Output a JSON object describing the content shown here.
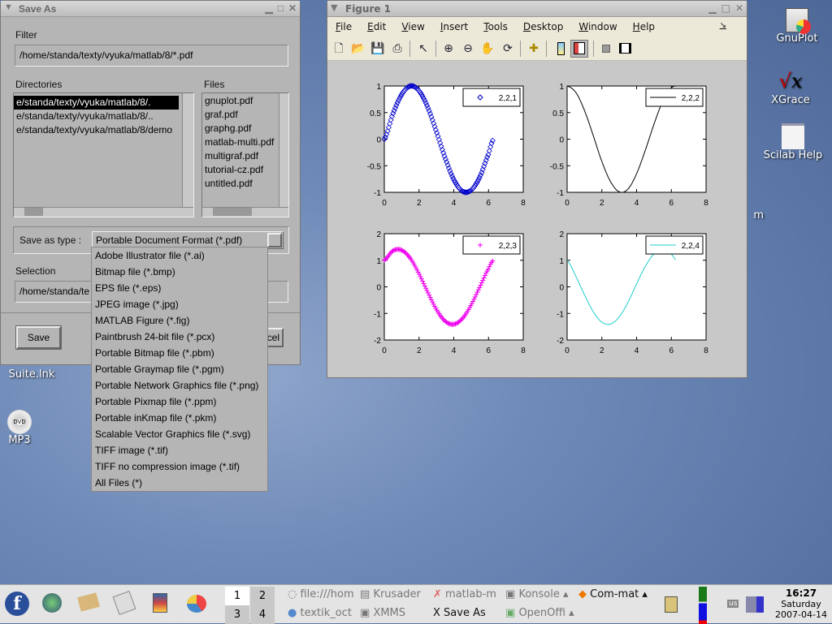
{
  "save_dialog": {
    "title": "Save As",
    "filter_label": "Filter",
    "filter_value": "/home/standa/texty/vyuka/matlab/8/*.pdf",
    "directories_label": "Directories",
    "directories": [
      "e/standa/texty/vyuka/matlab/8/.",
      "e/standa/texty/vyuka/matlab/8/..",
      "e/standa/texty/vyuka/matlab/8/demo"
    ],
    "files_label": "Files",
    "files": [
      "gnuplot.pdf",
      "graf.pdf",
      "graphg.pdf",
      "matlab-multi.pdf",
      "multigraf.pdf",
      "tutorial-cz.pdf",
      "untitled.pdf"
    ],
    "save_type_label": "Save as type :",
    "save_type_value": "Portable Document Format (*.pdf)",
    "selection_label": "Selection",
    "selection_value": "/home/standa/te",
    "save_button": "Save",
    "cancel_button": "cel",
    "type_options": [
      "Adobe Illustrator file (*.ai)",
      "Bitmap file (*.bmp)",
      "EPS file (*.eps)",
      "JPEG image (*.jpg)",
      "MATLAB Figure (*.fig)",
      "Paintbrush 24-bit file (*.pcx)",
      "Portable Bitmap file (*.pbm)",
      "Portable Graymap file (*.pgm)",
      "Portable Network Graphics file (*.png)",
      "Portable Pixmap file (*.ppm)",
      "Portable inKmap file (*.pkm)",
      "Scalable Vector Graphics file (*.svg)",
      "TIFF image (*.tif)",
      "TIFF no compression image (*.tif)",
      "All Files (*)"
    ]
  },
  "figure": {
    "title": "Figure 1",
    "menu": [
      "File",
      "Edit",
      "View",
      "Insert",
      "Tools",
      "Desktop",
      "Window",
      "Help"
    ],
    "toolbar": [
      "new-file",
      "open-file",
      "save",
      "print",
      "select-arrow",
      "zoom-in",
      "zoom-out",
      "pan-hand",
      "rotate-3d",
      "insert-data-cursor",
      "colorbar",
      "legend",
      "hide-plot-tools",
      "show-plot-tools"
    ]
  },
  "chart_data": [
    {
      "type": "scatter",
      "marker": "diamond",
      "color": "#0000cc",
      "legend": "2,2,1",
      "legend_placement": "top-right",
      "xlim": [
        0,
        8
      ],
      "ylim": [
        -1,
        1
      ],
      "xticks": [
        "0",
        "2",
        "4",
        "6",
        "8"
      ],
      "yticks": [
        "-1",
        "-0.5",
        "0",
        "0.5",
        "1"
      ],
      "x": [
        0,
        0.5,
        1,
        1.5,
        2,
        2.5,
        3,
        3.5,
        4,
        4.5,
        5,
        5.5,
        6,
        6.28
      ],
      "y": [
        0,
        0.48,
        0.84,
        1.0,
        0.91,
        0.6,
        0.14,
        -0.35,
        -0.76,
        -0.98,
        -0.96,
        -0.71,
        -0.28,
        0
      ]
    },
    {
      "type": "line",
      "color": "#000000",
      "legend": "2,2,2",
      "legend_placement": "top-right",
      "xlim": [
        0,
        8
      ],
      "ylim": [
        -1,
        1
      ],
      "xticks": [
        "0",
        "2",
        "4",
        "6",
        "8"
      ],
      "yticks": [
        "-1",
        "-0.5",
        "0",
        "0.5",
        "1"
      ],
      "x": [
        0,
        0.5,
        1,
        1.5,
        2,
        2.5,
        3,
        3.5,
        4,
        4.5,
        5,
        5.5,
        6,
        6.28
      ],
      "y": [
        1,
        0.88,
        0.54,
        0.07,
        -0.42,
        -0.8,
        -0.99,
        -0.94,
        -0.65,
        -0.21,
        0.28,
        0.71,
        0.96,
        1
      ]
    },
    {
      "type": "scatter",
      "marker": "plus",
      "color": "#ee00ee",
      "legend": "2,2,3",
      "legend_placement": "top-right",
      "xlim": [
        0,
        8
      ],
      "ylim": [
        -2,
        2
      ],
      "xticks": [
        "0",
        "2",
        "4",
        "6",
        "8"
      ],
      "yticks": [
        "-2",
        "-1",
        "0",
        "1",
        "2"
      ],
      "x": [
        0,
        0.5,
        1,
        1.5,
        2,
        2.5,
        3,
        3.5,
        4,
        4.5,
        5,
        5.5,
        6,
        6.28
      ],
      "y": [
        1,
        1.36,
        1.38,
        1.07,
        0.49,
        -0.2,
        -0.85,
        -1.29,
        -1.41,
        -1.19,
        -0.68,
        0.0,
        0.68,
        1
      ]
    },
    {
      "type": "line",
      "color": "#22cccc",
      "legend": "2,2,4",
      "legend_placement": "top-right",
      "xlim": [
        0,
        8
      ],
      "ylim": [
        -2,
        2
      ],
      "xticks": [
        "0",
        "2",
        "4",
        "6",
        "8"
      ],
      "yticks": [
        "-2",
        "-1",
        "0",
        "1",
        "2"
      ],
      "x": [
        0,
        0.5,
        1,
        1.5,
        2,
        2.5,
        3,
        3.5,
        4,
        4.5,
        5,
        5.5,
        6,
        6.28
      ],
      "y": [
        1,
        0.4,
        -0.3,
        -0.93,
        -1.33,
        -1.4,
        -1.13,
        -0.59,
        0.11,
        0.77,
        1.24,
        1.42,
        1.24,
        1
      ]
    }
  ],
  "desktop": {
    "icons": [
      "GnuPlot",
      "XGrace",
      "Scilab Help",
      "Suite.lnk",
      "MP3",
      "m"
    ]
  },
  "taskbar": {
    "pager": [
      "1",
      "2",
      "3",
      "4"
    ],
    "tasks": [
      "file:///hom",
      "Krusader",
      "matlab-m",
      "Konsole",
      "Com-mat",
      "textik_oct",
      "XMMS",
      "Save As",
      "OpenOffi"
    ],
    "keyboard": "us",
    "clock_time": "16:27",
    "clock_day": "Saturday",
    "clock_date": "2007-04-14"
  }
}
